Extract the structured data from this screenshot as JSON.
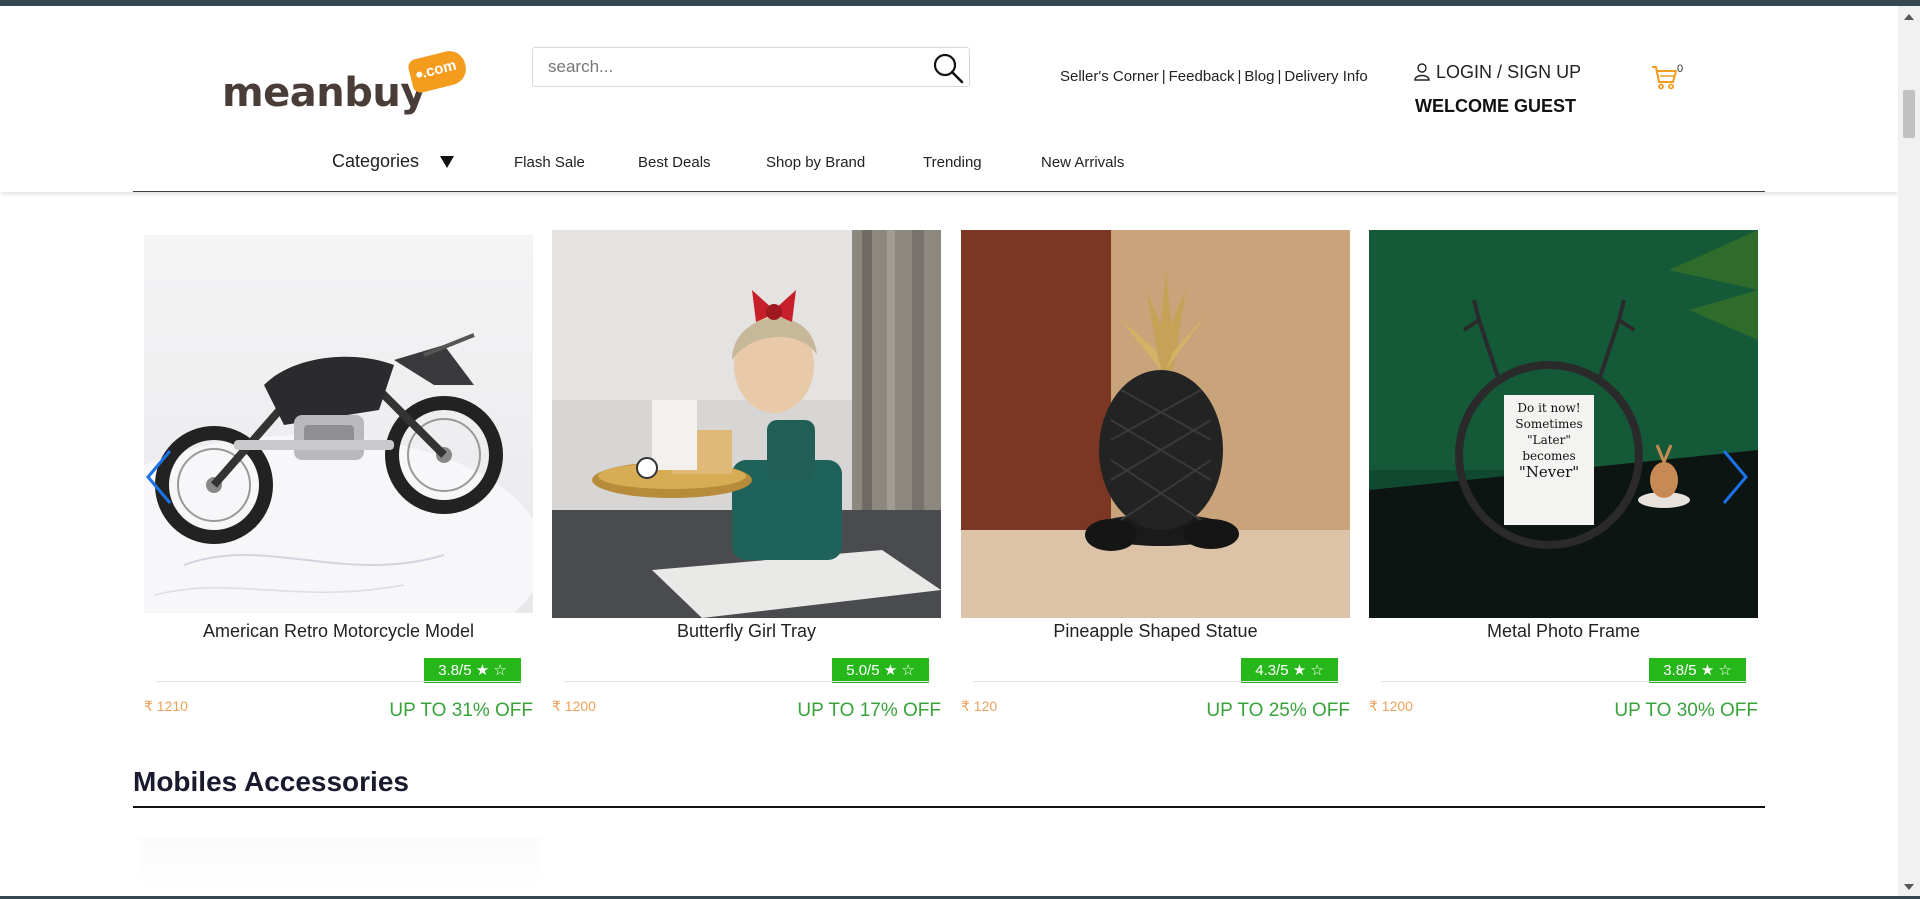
{
  "brand": {
    "logo_text": "meanbuy",
    "logo_tag": ".com"
  },
  "search": {
    "placeholder": "search..."
  },
  "top_links": [
    "Seller's Corner",
    "Feedback",
    "Blog",
    "Delivery Info"
  ],
  "top_links_separator": "|",
  "account": {
    "login": "LOGIN",
    "slash": "/",
    "signup": "SIGN UP",
    "welcome": "WELCOME GUEST"
  },
  "cart": {
    "count": "0"
  },
  "nav": {
    "categories": "Categories",
    "links": [
      "Flash Sale",
      "Best Deals",
      "Shop by Brand",
      "Trending",
      "New Arrivals"
    ]
  },
  "products": [
    {
      "name": "American Retro Motorcycle Model",
      "rating": "3.8/5 ★ ☆",
      "price": "₹ 1210",
      "discount": "UP TO 31% OFF"
    },
    {
      "name": "Butterfly Girl Tray",
      "rating": "5.0/5 ★ ☆",
      "price": "₹ 1200",
      "discount": "UP TO 17% OFF"
    },
    {
      "name": "Pineapple Shaped Statue",
      "rating": "4.3/5 ★ ☆",
      "price": "₹ 120",
      "discount": "UP TO 25% OFF"
    },
    {
      "name": "Metal Photo Frame",
      "rating": "3.8/5 ★ ☆",
      "price": "₹ 1200",
      "discount": "UP TO 30% OFF"
    }
  ],
  "photo_note_lines": [
    "Do it now!",
    "Sometimes",
    "\"Later\"",
    "becomes",
    "\"Never\""
  ],
  "section": {
    "title": "Mobiles Accessories"
  },
  "colors": {
    "accent": "#f39c1e",
    "rating_bg": "#26b81a",
    "discount": "#38a33a",
    "price": "#f0a05a",
    "arrow": "#1a73e8"
  }
}
